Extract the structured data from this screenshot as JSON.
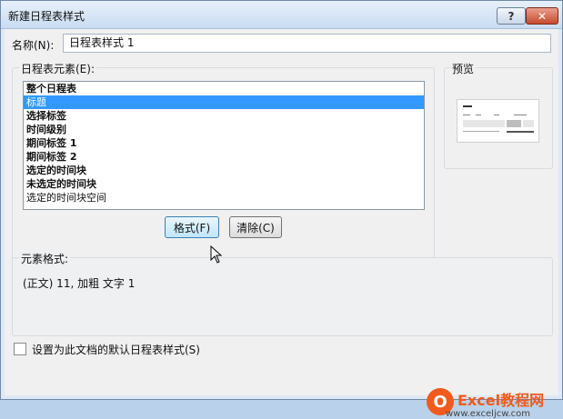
{
  "window": {
    "title": "新建日程表样式",
    "help_button": "?",
    "close_button": "✕"
  },
  "name_field": {
    "label": "名称(N):",
    "value": "日程表样式 1"
  },
  "elements_group": {
    "label": "日程表元素(E):",
    "items": [
      {
        "label": "整个日程表",
        "state": "bold"
      },
      {
        "label": "标题",
        "state": "selected"
      },
      {
        "label": "选择标签",
        "state": "bold"
      },
      {
        "label": "时间级别",
        "state": "bold"
      },
      {
        "label": "期间标签 1",
        "state": "bold"
      },
      {
        "label": "期间标签 2",
        "state": "bold"
      },
      {
        "label": "选定的时间块",
        "state": "bold"
      },
      {
        "label": "未选定的时间块",
        "state": "bold"
      },
      {
        "label": "选定的时间块空间",
        "state": "plain"
      }
    ],
    "format_button": "格式(F)",
    "clear_button": "清除(C)"
  },
  "preview_group": {
    "label": "预览"
  },
  "element_format": {
    "label": "元素格式:",
    "text": "(正文) 11, 加粗 文字 1"
  },
  "default_checkbox": {
    "label": "设置为此文档的默认日程表样式(S)",
    "checked": false
  },
  "watermark": {
    "logo_letter": "O",
    "title": "Excel教程网",
    "url": "www.exceljcw.com"
  },
  "colors": {
    "selection": "#3399ff",
    "watermark": "#f05a1c"
  }
}
